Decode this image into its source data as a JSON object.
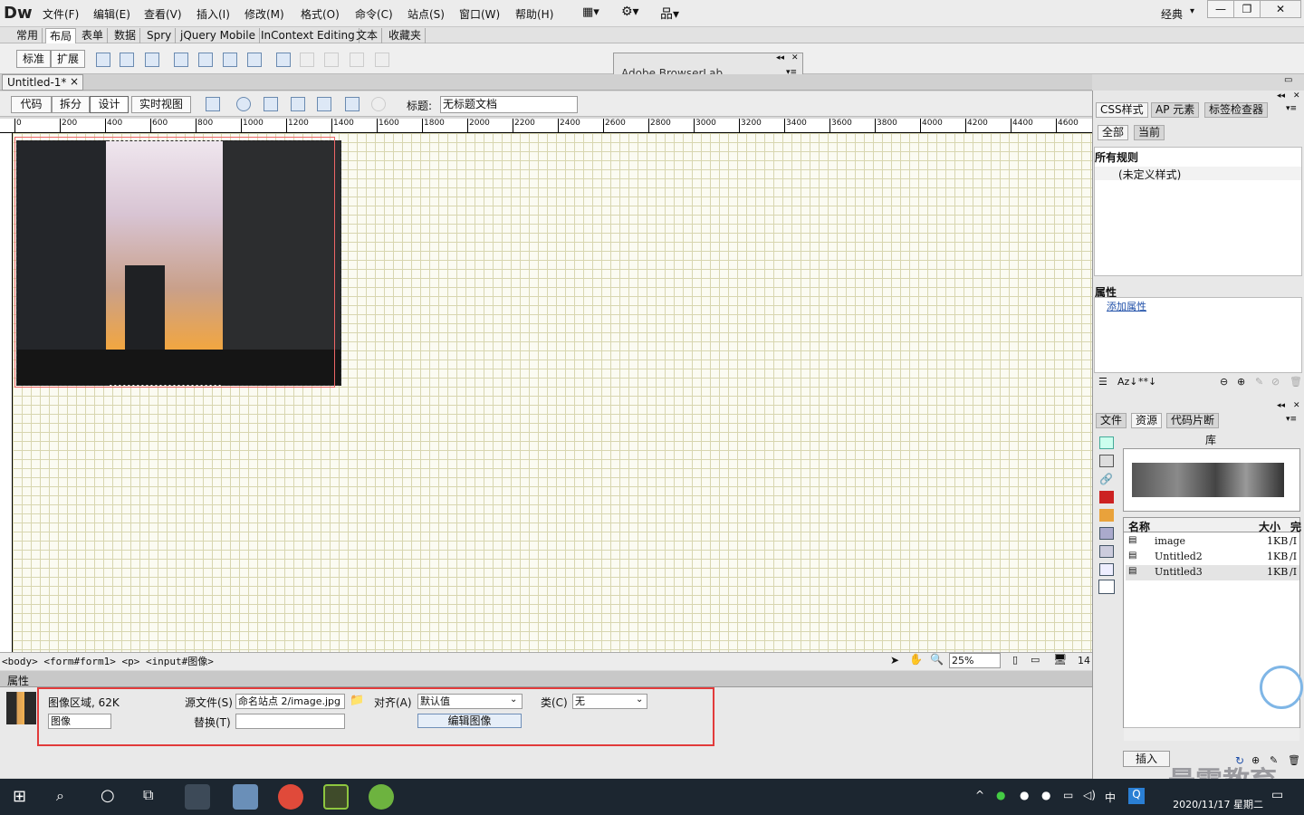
{
  "app": {
    "logo": "Dw",
    "workspace": "经典",
    "window_buttons": [
      "—",
      "❐",
      "✕"
    ]
  },
  "menu": [
    "文件(F)",
    "编辑(E)",
    "查看(V)",
    "插入(I)",
    "修改(M)",
    "格式(O)",
    "命令(C)",
    "站点(S)",
    "窗口(W)",
    "帮助(H)"
  ],
  "insert_tabs": [
    "常用",
    "布局",
    "表单",
    "数据",
    "Spry",
    "jQuery Mobile",
    "InContext Editing",
    "文本",
    "收藏夹"
  ],
  "layout_buttons": [
    "标准",
    "扩展"
  ],
  "browserlab": "Adobe BrowserLab",
  "document": {
    "tab": "Untitled-1*",
    "close": "×"
  },
  "view_buttons": [
    "代码",
    "拆分",
    "设计",
    "实时视图"
  ],
  "title_label": "标题:",
  "title_value": "无标题文档",
  "ruler": [
    "0",
    "200",
    "400",
    "600",
    "800",
    "1000",
    "1200",
    "1400",
    "1600",
    "1800",
    "2000",
    "2200",
    "2400",
    "2600",
    "2800",
    "3000",
    "3200",
    "3400",
    "3600",
    "3800",
    "4000",
    "4200",
    "4400",
    "4600"
  ],
  "status": {
    "tags": "<body> <form#form1> <p> <input#图像>",
    "zoom": "25%",
    "size": "14"
  },
  "properties": {
    "header": "属性",
    "image_area": "图像区域, 62K",
    "name": "图像",
    "src_label": "源文件(S)",
    "src_value": "命名站点 2/image.jpg",
    "alt_label": "替换(T)",
    "alt_value": "",
    "align_label": "对齐(A)",
    "align_value": "默认值",
    "class_label": "类(C)",
    "class_value": "无",
    "edit_button": "编辑图像"
  },
  "css_panel": {
    "tabs": [
      "CSS样式",
      "AP 元素",
      "标签检查器"
    ],
    "modes": [
      "全部",
      "当前"
    ],
    "all_rules": "所有规则",
    "rule": "(未定义样式)",
    "props": "属性",
    "add_prop": "添加属性"
  },
  "files_panel": {
    "tabs": [
      "文件",
      "资源",
      "代码片断"
    ],
    "library": "库",
    "cols": [
      "名称",
      "大小",
      "完"
    ],
    "items": [
      {
        "name": "image",
        "size": "1KB",
        "x": "/I"
      },
      {
        "name": "Untitled2",
        "size": "1KB",
        "x": "/I"
      },
      {
        "name": "Untitled3",
        "size": "1KB",
        "x": "/I"
      }
    ],
    "insert": "插入"
  },
  "taskbar": {
    "ime": "中",
    "time": "",
    "date": "2020/11/17 星期二"
  },
  "watermark": "最需教育"
}
